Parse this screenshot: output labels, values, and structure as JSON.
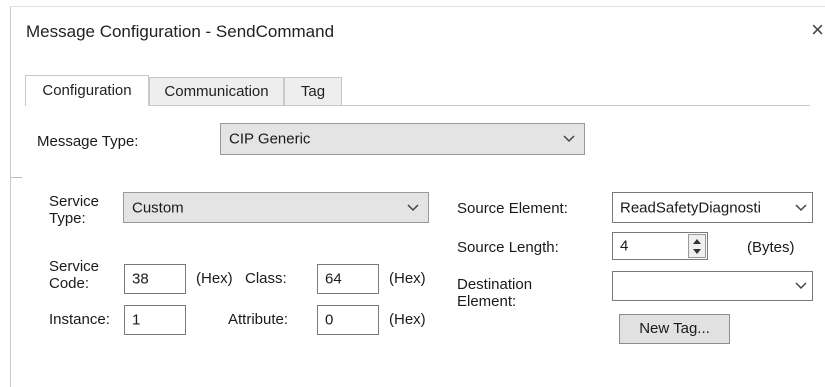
{
  "window": {
    "title": "Message Configuration - SendCommand",
    "close_glyph": "×"
  },
  "tabs": [
    {
      "label": "Configuration",
      "active": true
    },
    {
      "label": "Communication",
      "active": false
    },
    {
      "label": "Tag",
      "active": false
    }
  ],
  "config": {
    "message_type_label": "Message Type:",
    "message_type_value": "CIP Generic",
    "service_type_label": "Service\nType:",
    "service_type_value": "Custom",
    "service_code_label": "Service\nCode:",
    "service_code_value": "38",
    "hex_label": "(Hex)",
    "class_label": "Class:",
    "class_value": "64",
    "instance_label": "Instance:",
    "instance_value": "1",
    "attribute_label": "Attribute:",
    "attribute_value": "0",
    "source_element_label": "Source Element:",
    "source_element_value": "ReadSafetyDiagnosti",
    "source_length_label": "Source Length:",
    "source_length_value": "4",
    "bytes_label": "(Bytes)",
    "destination_element_label": "Destination\nElement:",
    "destination_element_value": "",
    "new_tag_label": "New Tag..."
  },
  "icons": {
    "dropdown": "chevron-down-icon",
    "spinner": "spin-up-down-icon",
    "close": "close-icon"
  }
}
